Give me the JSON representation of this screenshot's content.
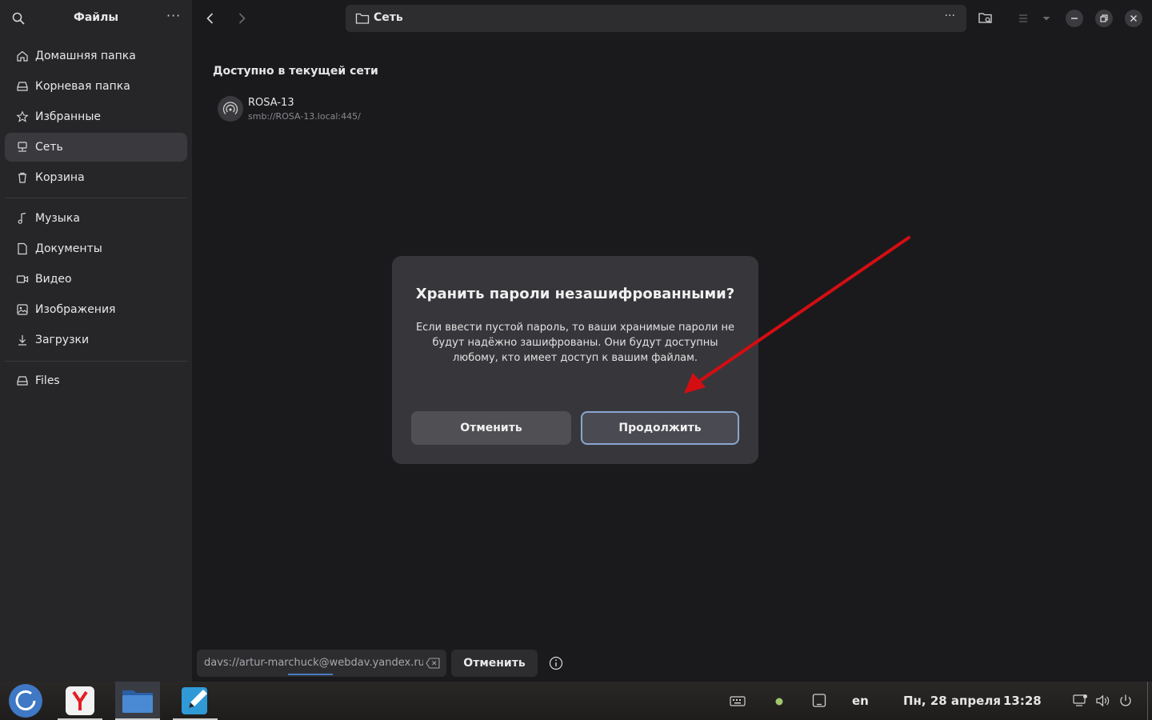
{
  "sidebar": {
    "title": "Файлы",
    "more": "···",
    "items": [
      {
        "label": "Домашняя папка",
        "icon": "home-icon"
      },
      {
        "label": "Корневая папка",
        "icon": "drive-icon"
      },
      {
        "label": "Избранные",
        "icon": "star-icon"
      },
      {
        "label": "Сеть",
        "icon": "network-icon",
        "active": true
      },
      {
        "label": "Корзина",
        "icon": "trash-icon"
      },
      {
        "label": "Музыка",
        "icon": "music-icon"
      },
      {
        "label": "Документы",
        "icon": "document-icon"
      },
      {
        "label": "Видео",
        "icon": "video-icon"
      },
      {
        "label": "Изображения",
        "icon": "image-icon"
      },
      {
        "label": "Загрузки",
        "icon": "download-icon"
      },
      {
        "label": "Files",
        "icon": "drive-icon"
      }
    ]
  },
  "header": {
    "path": "Сеть",
    "more": "···"
  },
  "content": {
    "section_title": "Доступно в текущей сети",
    "item": {
      "name": "ROSA-13",
      "url": "smb://ROSA-13.local:445/"
    }
  },
  "dialog": {
    "title": "Хранить пароли незашифрованными?",
    "body": "Если ввести пустой пароль, то ваши хранимые пароли не будут надёжно зашифрованы. Они будут доступны любому, кто имеет доступ к вашим файлам.",
    "cancel_label": "Отменить",
    "continue_label": "Продолжить"
  },
  "bottom": {
    "address": "davs://artur-marchuck@webdav.yandex.ru",
    "cancel_label": "Отменить"
  },
  "taskbar": {
    "language": "en",
    "date": "Пн, 28 апреля",
    "time": "13:28"
  },
  "colors": {
    "accent": "#8aa6d0",
    "arrow": "#d40d12",
    "status_dot": "#9fc86d"
  }
}
